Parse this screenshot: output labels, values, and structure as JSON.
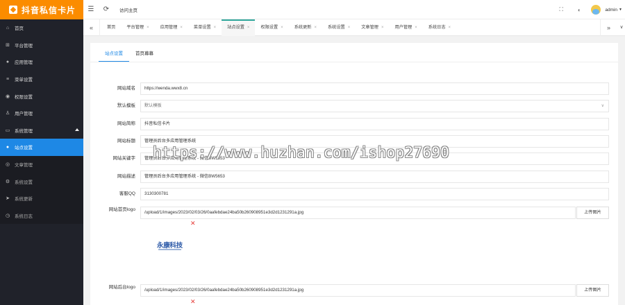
{
  "brand": {
    "name": "抖音私信卡片",
    "accent": "#fb8c00"
  },
  "sidebar": {
    "bg": "#20222a",
    "active_color": "#1e88e5",
    "items": [
      {
        "label": "首页",
        "icon": "home-icon"
      },
      {
        "label": "平台管理",
        "icon": "grid-icon"
      },
      {
        "label": "应用管理",
        "icon": "app-icon"
      },
      {
        "label": "菜单设置",
        "icon": "menu-icon"
      },
      {
        "label": "权限设置",
        "icon": "shield-icon"
      },
      {
        "label": "用户管理",
        "icon": "user-icon"
      },
      {
        "label": "系统管理",
        "icon": "monitor-icon"
      },
      {
        "label": "站点设置",
        "icon": "dot-icon"
      },
      {
        "label": "文章管理",
        "icon": "article-icon"
      },
      {
        "label": "系统设置",
        "icon": "gear-icon"
      },
      {
        "label": "系统更新",
        "icon": "send-icon"
      },
      {
        "label": "系统日志",
        "icon": "log-icon"
      }
    ]
  },
  "header": {
    "breadcrumb": "访问主页",
    "user": "admin"
  },
  "tabs": [
    {
      "label": "首页",
      "closable": false
    },
    {
      "label": "平台管理",
      "closable": true
    },
    {
      "label": "应用管理",
      "closable": true
    },
    {
      "label": "菜单设置",
      "closable": true
    },
    {
      "label": "站点设置",
      "closable": true,
      "active": true
    },
    {
      "label": "权限设置",
      "closable": true
    },
    {
      "label": "系统更新",
      "closable": true
    },
    {
      "label": "系统设置",
      "closable": true
    },
    {
      "label": "文章管理",
      "closable": true
    },
    {
      "label": "用户管理",
      "closable": true
    },
    {
      "label": "系统日志",
      "closable": true
    }
  ],
  "close_glyph": "×",
  "subtabs": [
    "站点设置",
    "首页幕幕"
  ],
  "form": {
    "site_domain": {
      "label": "网站域名",
      "value": "https://wenda.wwx8.cn"
    },
    "default_template": {
      "label": "默认模板",
      "value": "默认模板"
    },
    "site_short_name": {
      "label": "网站简称",
      "value": "抖音私信卡片"
    },
    "site_title": {
      "label": "网站标题",
      "value": "管理员后台多应用管理系统"
    },
    "site_keywords": {
      "label": "网站关键字",
      "value": "管理员后台多应用管理系统 - 微信BW5653"
    },
    "site_description": {
      "label": "网站描述",
      "value": "管理员后台多应用管理系统 - 微信BW5653"
    },
    "service_qq": {
      "label": "客服QQ",
      "value": "3130300781"
    },
    "home_logo": {
      "label": "网站首页logo",
      "value": "/upload/1/images/2023/02/03/26/0aafebdae24ba50b260908951e3d2d1231291a.jpg"
    },
    "admin_logo": {
      "label": "网站后台logo",
      "value": "/upload/1/images/2023/02/03/26/0aafebdae24ba50b260908951e3d2d1231291a.jpg"
    },
    "upload_label": "上传图片"
  },
  "logo_preview_text": "永康科技",
  "watermark": "https://www.huzhan.com/ishop27690"
}
